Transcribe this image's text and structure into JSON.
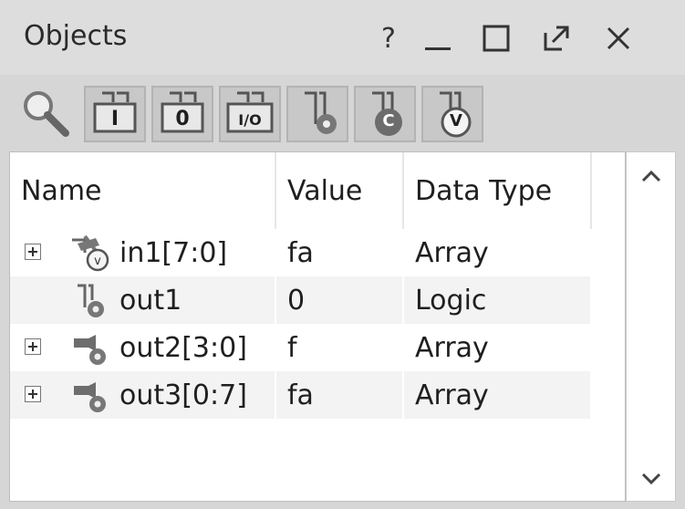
{
  "window": {
    "title": "Objects",
    "help_glyph": "?",
    "minimize_glyph": "_",
    "close_glyph": "✕"
  },
  "toolbar": {
    "buttons": [
      {
        "label": "I",
        "icon": "input-port-icon"
      },
      {
        "label": "0",
        "icon": "output-port-icon"
      },
      {
        "label": "I/O",
        "icon": "inout-port-icon"
      },
      {
        "label": "",
        "icon": "internal-signal-icon"
      },
      {
        "label": "C",
        "icon": "constant-icon"
      },
      {
        "label": "V",
        "icon": "variable-icon"
      }
    ]
  },
  "table": {
    "columns": [
      "Name",
      "Value",
      "Data Type"
    ],
    "rows": [
      {
        "name": "in1[7:0]",
        "value": "fa",
        "type": "Array",
        "expandable": true,
        "icon": "bus-variable-icon"
      },
      {
        "name": "out1",
        "value": "0",
        "type": "Logic",
        "expandable": false,
        "icon": "signal-output-icon"
      },
      {
        "name": "out2[3:0]",
        "value": "f",
        "type": "Array",
        "expandable": true,
        "icon": "bus-output-icon"
      },
      {
        "name": "out3[0:7]",
        "value": "fa",
        "type": "Array",
        "expandable": true,
        "icon": "bus-output-icon"
      }
    ]
  },
  "colors": {
    "background": "#d6d6d6",
    "row_alt": "#f3f3f3",
    "button_face": "#c8c8c8"
  }
}
